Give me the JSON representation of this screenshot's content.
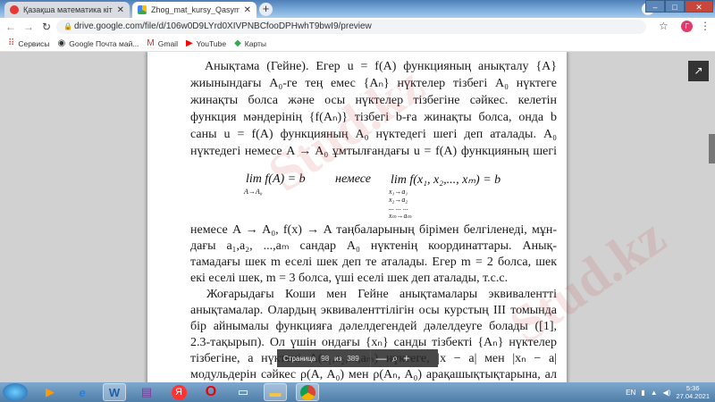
{
  "browser": {
    "tabs": [
      {
        "title": "Қазақша математика кітаптары",
        "active": false,
        "favicon": "red-circle-icon"
      },
      {
        "title": "Zhog_mat_kursy_Qasymov.pdf - Google Drive",
        "active": true,
        "favicon": "google-drive-icon"
      }
    ],
    "new_tab": "+",
    "url": "drive.google.com/file/d/106w0D9LYrd0XIVPNBCfooDPHwhT9bwI9/preview",
    "avatar_letter": "Г",
    "bookmarks": [
      {
        "label": "Сервисы",
        "icon": "apps-grid-icon"
      },
      {
        "label": "Google Почта май...",
        "icon": "globe-icon"
      },
      {
        "label": "Gmail",
        "icon": "gmail-icon"
      },
      {
        "label": "YouTube",
        "icon": "youtube-icon"
      },
      {
        "label": "Карты",
        "icon": "maps-icon"
      }
    ],
    "accent": "#e23a6b"
  },
  "document": {
    "lines_top": [
      "Анықтама (Гейне). Егер u = f(A) функцияның анықталу {A}",
      "жиынындағы A₀-ге тең емес {Aₙ}   нүктелер тізбегі A₀ нүктеге",
      "жинақты болса және осы нүктелер тізбегіне сәйкес. келетін",
      "функция мәндерінің {f(Aₙ)} тізбегі b-ға жинақты болса, онда b",
      "саны u = f(A) функцияның A₀ нүктедегі шегі деп аталады. A₀",
      "нүктедегі немесе A → A₀ ұмтылғандағы u = f(A) функцияның шегі"
    ],
    "formula": {
      "left": "lim f(A) = b",
      "left_sub": "A→A₀",
      "middle": "немесе",
      "right": "lim  f(x₁, x₂,..., xₘ) = b",
      "right_sub": [
        "x₁→a₁",
        "x₂→a₂",
        "... ... ...",
        "xₘ→aₘ"
      ]
    },
    "lines_bottom": [
      "немесе A → A₀, f(x) → A таңбаларының бірімен белгіленеді, мұн-",
      "дағы a₁,a₂, ...,aₘ сандар A₀ нүктенің координаттары. Анық-",
      "тамадағы шек m еселі шек деп те аталады. Егер m = 2 болса, шек",
      "екі еселі шек, m = 3 болса, үші еселі шек деп аталады, т.с.с.",
      "Жоғарыдағы Коши мен Гейне анықтамалары эквивалентті",
      "анықтамалар. Олардың эквиваленттілігін осы курстың III томында",
      "бір айнымалы функцияға дәлелдегендей дәлелдеуге болады ([1],",
      "2.3-тақырып). Ол үшін ондағы {xₙ} санды тізбекті {Aₙ}   нүктелер",
      "тізбегіне, a нүктені A(a₁,a₂,...,aₘ) нүктеге, |x − a| мен |xₙ − a|",
      "модульдерін сәйкес ρ(A, A₀) мен ρ(Aₙ, A₀) арақашықтықтарына, ал"
    ]
  },
  "pager": {
    "label": "Страница",
    "current": "98",
    "of": "из",
    "total": "389",
    "zoom_out": "—",
    "zoom_in": "+"
  },
  "taskbar": {
    "apps": [
      "media-player-icon",
      "internet-explorer-icon",
      "word-icon",
      "winrar-icon",
      "yandex-icon",
      "opera-icon",
      "notepad-icon",
      "explorer-icon",
      "chrome-icon"
    ],
    "lang": "EN",
    "time": "5:36",
    "date": "27.04.2021"
  }
}
